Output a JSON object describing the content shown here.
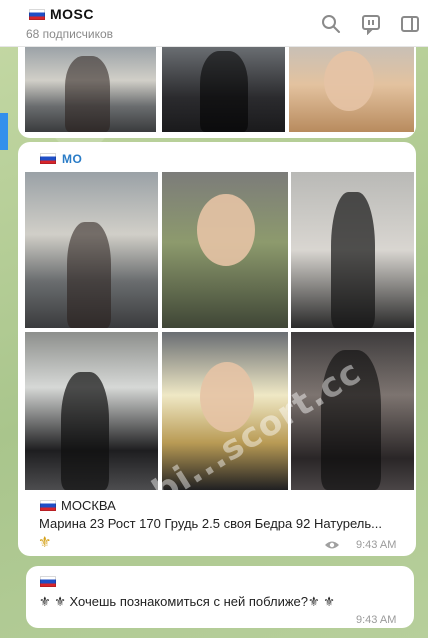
{
  "header": {
    "title": "MOSC",
    "subscribers": "68 подписчиков",
    "icons": [
      "search-icon",
      "comments-icon",
      "sidebar-toggle-icon"
    ]
  },
  "post": {
    "sender": "МО",
    "city": "МОСКВА",
    "caption": "Марина 23 Рост 170 Грудь 2.5 своя  Бедра 92 Натурель...",
    "fleur": "⚜",
    "watermark": "bi...scort.cc",
    "time": "9:43 AM"
  },
  "next_message": {
    "text": "⚜ ⚜ Хочешь познакомиться с ней поближе?⚜ ⚜",
    "time": "9:43 AM"
  },
  "colors": {
    "accent": "#3390ec",
    "sender": "#2a7cc7",
    "fleur": "#d4a017",
    "background": "#b9cf9b"
  }
}
